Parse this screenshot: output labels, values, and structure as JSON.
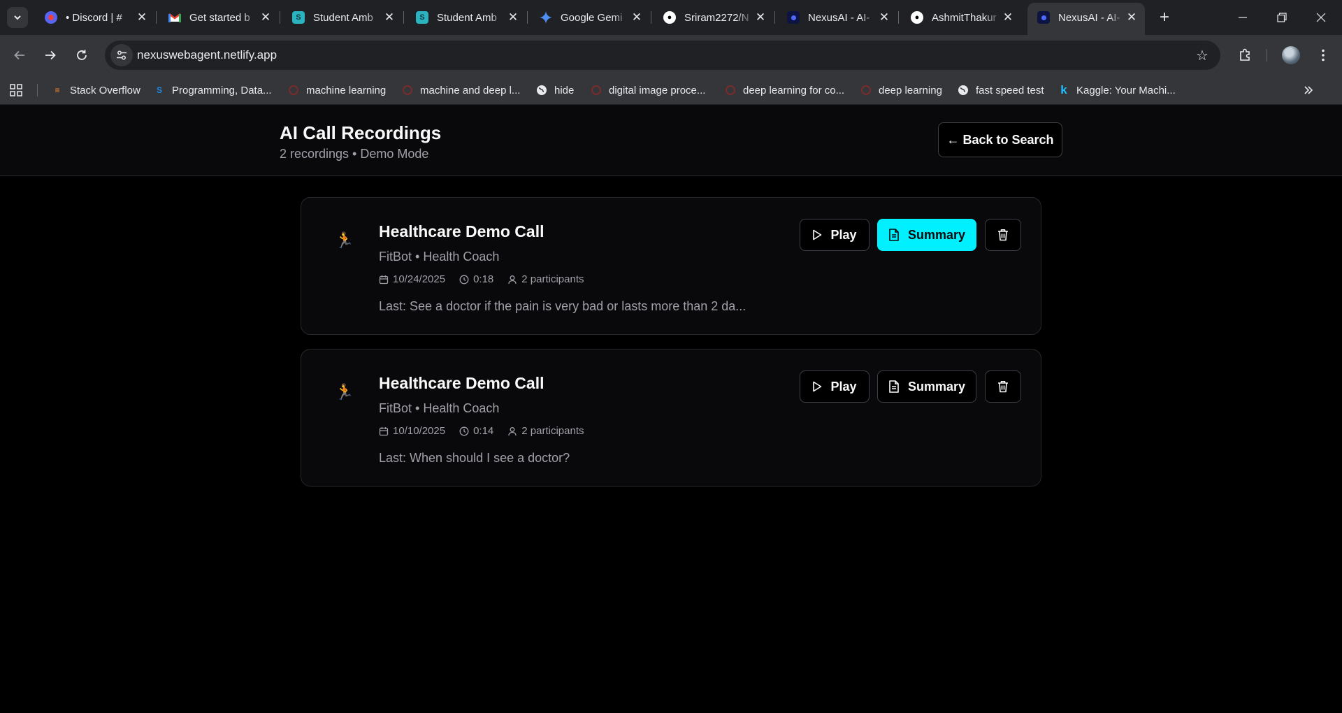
{
  "browser": {
    "tabs": [
      {
        "title": "• Discord | # ",
        "favicon": "discord-icon",
        "color": "#5865f2"
      },
      {
        "title": "Get started b",
        "favicon": "gmail-icon",
        "color": "#ea4335"
      },
      {
        "title": "Student Amb",
        "favicon": "student-ambassador-icon",
        "color": "#2bb3c0"
      },
      {
        "title": "Student Amb",
        "favicon": "student-ambassador-icon",
        "color": "#2bb3c0"
      },
      {
        "title": "Google Gemi",
        "favicon": "gemini-icon",
        "color": "#4f8df5"
      },
      {
        "title": "Sriram2272/N",
        "favicon": "github-icon",
        "color": "#ffffff"
      },
      {
        "title": "NexusAI - AI-",
        "favicon": "nexusai-icon",
        "color": "#1a237e"
      },
      {
        "title": "AshmitThakur",
        "favicon": "github-icon",
        "color": "#ffffff"
      },
      {
        "title": "NexusAI - AI-",
        "favicon": "nexusai-icon",
        "color": "#1a237e"
      }
    ],
    "active_tab": 8,
    "url": "nexuswebagent.netlify.app",
    "bookmarks": [
      {
        "label": "Stack Overflow",
        "icon": "stackoverflow-icon"
      },
      {
        "label": "Programming, Data...",
        "icon": "s-icon"
      },
      {
        "label": "machine learning",
        "icon": "chatgpt-icon"
      },
      {
        "label": "machine and deep l...",
        "icon": "chatgpt-icon"
      },
      {
        "label": "hide",
        "icon": "globe-icon"
      },
      {
        "label": "digital image proce...",
        "icon": "chatgpt-icon"
      },
      {
        "label": "deep learning for co...",
        "icon": "chatgpt-icon"
      },
      {
        "label": "deep learning",
        "icon": "chatgpt-icon"
      },
      {
        "label": "fast speed test",
        "icon": "globe-icon"
      },
      {
        "label": "Kaggle: Your Machi...",
        "icon": "kaggle-icon"
      }
    ]
  },
  "page": {
    "title": "AI Call Recordings",
    "subtitle": "2 recordings • Demo Mode",
    "back_label": "← Back to Search",
    "accent_color": "#00f0ff",
    "buttons": {
      "play": "Play",
      "summary": "Summary"
    },
    "recordings": [
      {
        "emoji": "🏃",
        "title": "Healthcare Demo Call",
        "agent": "FitBot • Health Coach",
        "date": "10/24/2025",
        "duration": "0:18",
        "participants": "2 participants",
        "last": "Last: See a doctor if the pain is very bad or lasts more than 2 da...",
        "summary_active": true
      },
      {
        "emoji": "🏃",
        "title": "Healthcare Demo Call",
        "agent": "FitBot • Health Coach",
        "date": "10/10/2025",
        "duration": "0:14",
        "participants": "2 participants",
        "last": "Last: When should I see a doctor?",
        "summary_active": false
      }
    ]
  }
}
